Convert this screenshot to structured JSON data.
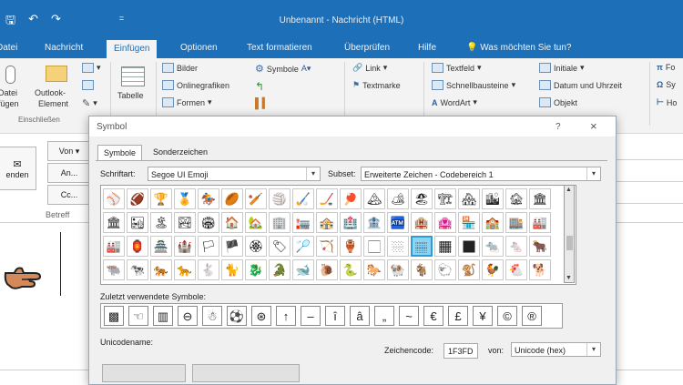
{
  "titlebar": {
    "window_title": "Unbenannt  -  Nachricht (HTML)",
    "qat_icons": [
      "save-icon",
      "undo-icon",
      "redo-icon",
      "customize-qat-icon"
    ]
  },
  "tabs": [
    {
      "label": "Datei"
    },
    {
      "label": "Nachricht"
    },
    {
      "label": "Einfügen"
    },
    {
      "label": "Optionen"
    },
    {
      "label": "Text formatieren"
    },
    {
      "label": "Überprüfen"
    },
    {
      "label": "Hilfe"
    },
    {
      "label": "Was möchten Sie tun?"
    }
  ],
  "ribbon": {
    "attach_file": [
      "Datei",
      "fügen"
    ],
    "outlook_element": [
      "Outlook-",
      "Element"
    ],
    "table": "Tabelle",
    "group_include": "Einschließen",
    "pictures": "Bilder",
    "online_pictures": "Onlinegrafiken",
    "shapes": "Formen",
    "symbols": "Symbole",
    "link": "Link",
    "bookmark": "Textmarke",
    "textbox": "Textfeld",
    "quick_parts": "Schnellbausteine",
    "wordart": "WordArt",
    "dropcap": "Initiale",
    "date_time": "Datum und Uhrzeit",
    "object": "Objekt",
    "formula": "Fo",
    "symbol_right": "Sy",
    "horizontal": "Ho"
  },
  "compose": {
    "send": "enden",
    "from": "Von",
    "to": "An...",
    "cc": "Cc...",
    "subject": "Betreff"
  },
  "dialog": {
    "title": "Symbol",
    "help": "?",
    "close": "×",
    "tab_symbols": "Symbole",
    "tab_special": "Sonderzeichen",
    "font_label": "Schriftart:",
    "font_value": "Segoe UI Emoji",
    "subset_label": "Subset:",
    "subset_value": "Erweiterte Zeichen - Codebereich 1",
    "recent_label": "Zuletzt verwendete Symbole:",
    "unicode_name_label": "Unicodename:",
    "charcode_label": "Zeichencode:",
    "charcode_value": "1F3FD",
    "from_label": "von:",
    "from_value": "Unicode (hex)"
  },
  "symbol_grid": [
    [
      "⚾",
      "🏈",
      "🏆",
      "🏅",
      "🏇",
      "🏉",
      "🏏",
      "🏐",
      "🏑",
      "🏒",
      "🏓",
      "🏔",
      "🏕",
      "🏖",
      "🏗",
      "🏘",
      "🏙",
      "🏚",
      "🏛"
    ],
    [
      "🏛",
      "🏜",
      "🏝",
      "🏞",
      "🏟",
      "🏠",
      "🏡",
      "🏢",
      "🏣",
      "🏤",
      "🏥",
      "🏦",
      "🏧",
      "🏨",
      "🏩",
      "🏪",
      "🏫",
      "🏬",
      "🏭"
    ],
    [
      "🏭",
      "🏮",
      "🏯",
      "🏰",
      "🏳",
      "🏴",
      "🏵",
      "🏷",
      "🏸",
      "🏹",
      "🏺",
      "🏻",
      "🏼",
      "🏽",
      "🏾",
      "🏿",
      "🐀",
      "🐁",
      "🐂"
    ],
    [
      "🐃",
      "🐄",
      "🐅",
      "🐆",
      "🐇",
      "🐈",
      "🐉",
      "🐊",
      "🐋",
      "🐌",
      "🐍",
      "🐎",
      "🐏",
      "🐐",
      "🐑",
      "🐒",
      "🐓",
      "🐔",
      "🐕"
    ]
  ],
  "recent_symbols": [
    "▩",
    "☜",
    "▥",
    "⊖",
    "☃",
    "⚽",
    "⊛",
    "↑",
    "–",
    "î",
    "â",
    "„",
    "~",
    "€",
    "£",
    "¥",
    "©",
    "®"
  ]
}
